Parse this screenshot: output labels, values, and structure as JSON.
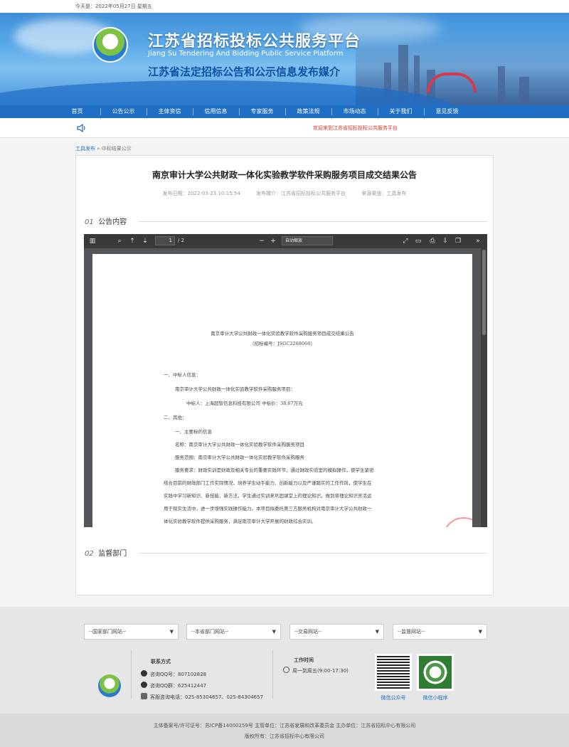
{
  "topbar": {
    "date": "今天是：2022年05月27日 星期五"
  },
  "banner": {
    "title_cn": "江苏省招标投标公共服务平台",
    "title_en": "Jiang Su Tendering And Bidding Public Service Platform",
    "subtitle": "江苏省法定招标公告和公示信息发布媒介"
  },
  "nav": {
    "items": [
      "首页",
      "公告公示",
      "主体资信",
      "信用信息",
      "专家服务",
      "政策法规",
      "市场动态",
      "关于我们",
      "意见反馈"
    ]
  },
  "notice": {
    "text": "欢迎来到江苏省招标投标公共服务平台"
  },
  "breadcrumb": {
    "home": "工具发布",
    "sep": "»",
    "current": "中标结果公示"
  },
  "article": {
    "title": "南京审计大学公共财政一体化实验教学软件采购服务项目成交结果公告",
    "publish_date": "发布日期：2022-03-23 10:15:54",
    "media": "发布媒介：江苏省招标投标公共服务平台",
    "source": "来源渠道：工具发布"
  },
  "sections": {
    "s1_num": "01",
    "s1_label": "公告内容",
    "s2_num": "02",
    "s2_label": "监督部门"
  },
  "viewer": {
    "page_current": "1",
    "page_total": "/ 2",
    "zoom": "自动缩放"
  },
  "pdf": {
    "title": "南京审计大学公共财政一体化实验教学软件采购服务项目成交结果公告",
    "number": "（招标编号：JSGC2268060）",
    "lines": [
      "一、中标人信息：",
      "南京审计大学公共财政一体化实验教学软件采购服务项目：",
      "中标人：上海超智信息科技有限公司 中标价：38.67万元",
      "二、其他：",
      "一、主要标的信息",
      "名称：南京审计大学公共财政一体化实验教学软件采购服务项目",
      "服务范围：南京审计大学公共财政一体化实验教学软件采购服务",
      "服务要求：财政实训是财政及相关专业的重要实践环节，通过财政实验室的模拟操作，使学生紧密",
      "结合目前的财政部门工作实际情况，培养学生动手能力、创新能力以及严谨踏实的工作作风，使学生在",
      "实践中学习新知识、新技能、新方法，学生通过实训来巩固课堂上的理论知识，做到将理论知识灵活运",
      "用于现实生活中，进一步增强实践操作能力。本项目拟委托第三方服务机构对南京审计大学公共财政一",
      "体化实验教学软件提供采购服务，满足南京审计大学开展的财政综合实训。"
    ]
  },
  "footer": {
    "selects": [
      "--国家部门网站--",
      "--本省部门网站--",
      "--交易网站--",
      "--监督网站--"
    ],
    "contact_title": "联系方式",
    "qq_consult": "咨询QQ号：807102828",
    "qq_group": "咨询QQ群：625412447",
    "phone": "客服咨询电话：025-85304657、025-84304657",
    "hours_title": "工作时间",
    "hours": "周一到周五(9:00-17:30)",
    "qr1_label": "微信公众号",
    "qr2_label": "微信小程序"
  },
  "bottom": {
    "line1": "主体备案号/许可证号：苏ICP备14000259号 主管单位：江苏省发展和改革委员会 主办单位：江苏省招标中心有限公司",
    "line2": "版权所有：江苏省招标中心有限公司"
  },
  "colors": {
    "nav": "#1f6fc4",
    "accent_red": "#e0301e"
  }
}
